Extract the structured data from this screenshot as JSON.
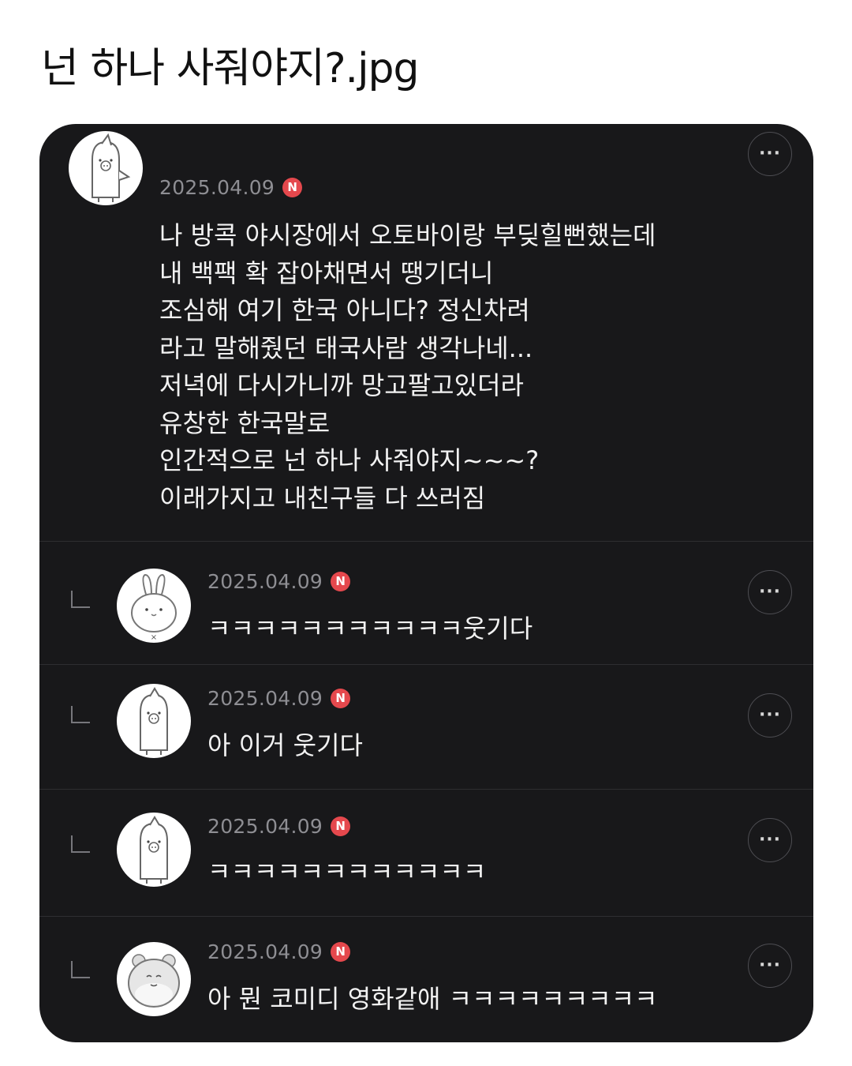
{
  "page": {
    "title": "넌 하나 사줘야지?.jpg"
  },
  "post": {
    "date": "2025.04.09",
    "badge": "N",
    "more_label": "···",
    "lines": [
      "나 방콕 야시장에서 오토바이랑 부딪힐뻔했는데",
      "내 백팩 확 잡아채면서 땡기더니",
      "조심해 여기 한국 아니다? 정신차려",
      "라고 말해줬던 태국사람 생각나네...",
      "저녁에 다시가니까 망고팔고있더라",
      "유창한 한국말로",
      "인간적으로 넌 하나 사줘야지~~~?",
      "이래가지고 내친구들 다 쓰러짐"
    ]
  },
  "replies": [
    {
      "date": "2025.04.09",
      "badge": "N",
      "text": "ㅋㅋㅋㅋㅋㅋㅋㅋㅋㅋㅋ웃기다",
      "avatar": "bunny-avatar",
      "more_label": "···"
    },
    {
      "date": "2025.04.09",
      "badge": "N",
      "text": "아 이거 웃기다",
      "avatar": "penguin-avatar",
      "more_label": "···"
    },
    {
      "date": "2025.04.09",
      "badge": "N",
      "text": "ㅋㅋㅋㅋㅋㅋㅋㅋㅋㅋㅋㅋ",
      "avatar": "penguin-avatar",
      "more_label": "···"
    },
    {
      "date": "2025.04.09",
      "badge": "N",
      "text": "아 뭔 코미디 영화같애 ㅋㅋㅋㅋㅋㅋㅋㅋㅋ",
      "avatar": "hamster-avatar",
      "more_label": "···"
    }
  ],
  "colors": {
    "card_bg": "#18181a",
    "badge": "#e5484d",
    "date": "#8e8e93",
    "text": "#f2f2f2"
  }
}
